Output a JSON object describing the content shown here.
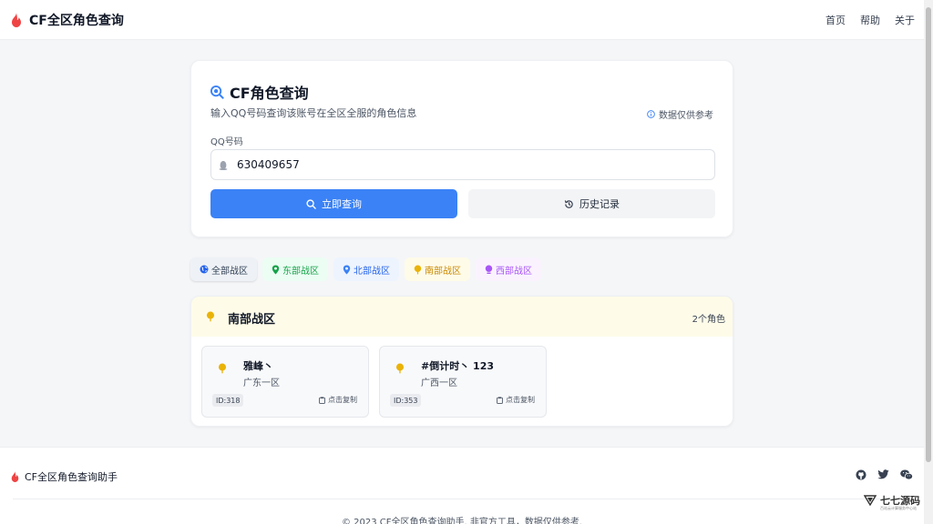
{
  "header": {
    "title": "CF全区角色查询",
    "nav": [
      "首页",
      "帮助",
      "关于"
    ]
  },
  "search": {
    "title": "CF角色查询",
    "subtitle": "输入QQ号码查询该账号在全区全服的角色信息",
    "note": "数据仅供参考",
    "field_label": "QQ号码",
    "qq_value": "630409657",
    "query_button": "立即查询",
    "history_button": "历史记录"
  },
  "tabs": [
    {
      "label": "全部战区",
      "color": "#334155"
    },
    {
      "label": "东部战区",
      "color": "#16a34a"
    },
    {
      "label": "北部战区",
      "color": "#2563eb"
    },
    {
      "label": "南部战区",
      "color": "#ca8a04"
    },
    {
      "label": "西部战区",
      "color": "#a855f7"
    }
  ],
  "result": {
    "region": "南部战区",
    "count": "2个角色",
    "roles": [
      {
        "name": "雅峰丶",
        "server": "广东一区",
        "id": "ID:318",
        "copy": "点击复制"
      },
      {
        "name": "#倒计时丶 123",
        "server": "广西一区",
        "id": "ID:353",
        "copy": "点击复制"
      }
    ]
  },
  "footer": {
    "brand": "CF全区角色查询助手",
    "copyright": "© 2023 CF全区角色查询助手. 非官方工具，数据仅供参考.",
    "social_icons": [
      "github-icon",
      "twitter-icon",
      "wechat-icon"
    ]
  },
  "watermark": {
    "text": "七七源码",
    "sub": "百站云计算服务中心站"
  },
  "colors": {
    "primary": "#3b82f6",
    "flame": "#ef4444",
    "south_pin": "#eab308"
  }
}
